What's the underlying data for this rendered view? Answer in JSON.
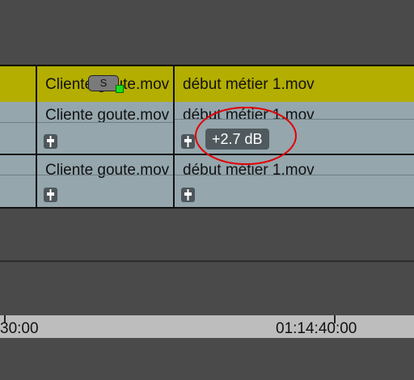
{
  "timeline": {
    "video_track": {
      "clip_left": "Cliente goute.mov",
      "clip_right": "début métier 1.mov",
      "solo_label": "S"
    },
    "audio_track_1": {
      "clip_left": "Cliente goute.mov",
      "clip_right": "début métier 1.mov",
      "gain_label": "+2.7 dB"
    },
    "audio_track_2": {
      "clip_left": "Cliente goute.mov",
      "clip_right": "début métier 1.mov"
    }
  },
  "ruler": {
    "left_timecode": "30:00",
    "right_timecode": "01:14:40:00"
  },
  "colors": {
    "video_clip": "#b3ae00",
    "audio_clip": "#95a6ad",
    "annotation": "#e00000"
  }
}
